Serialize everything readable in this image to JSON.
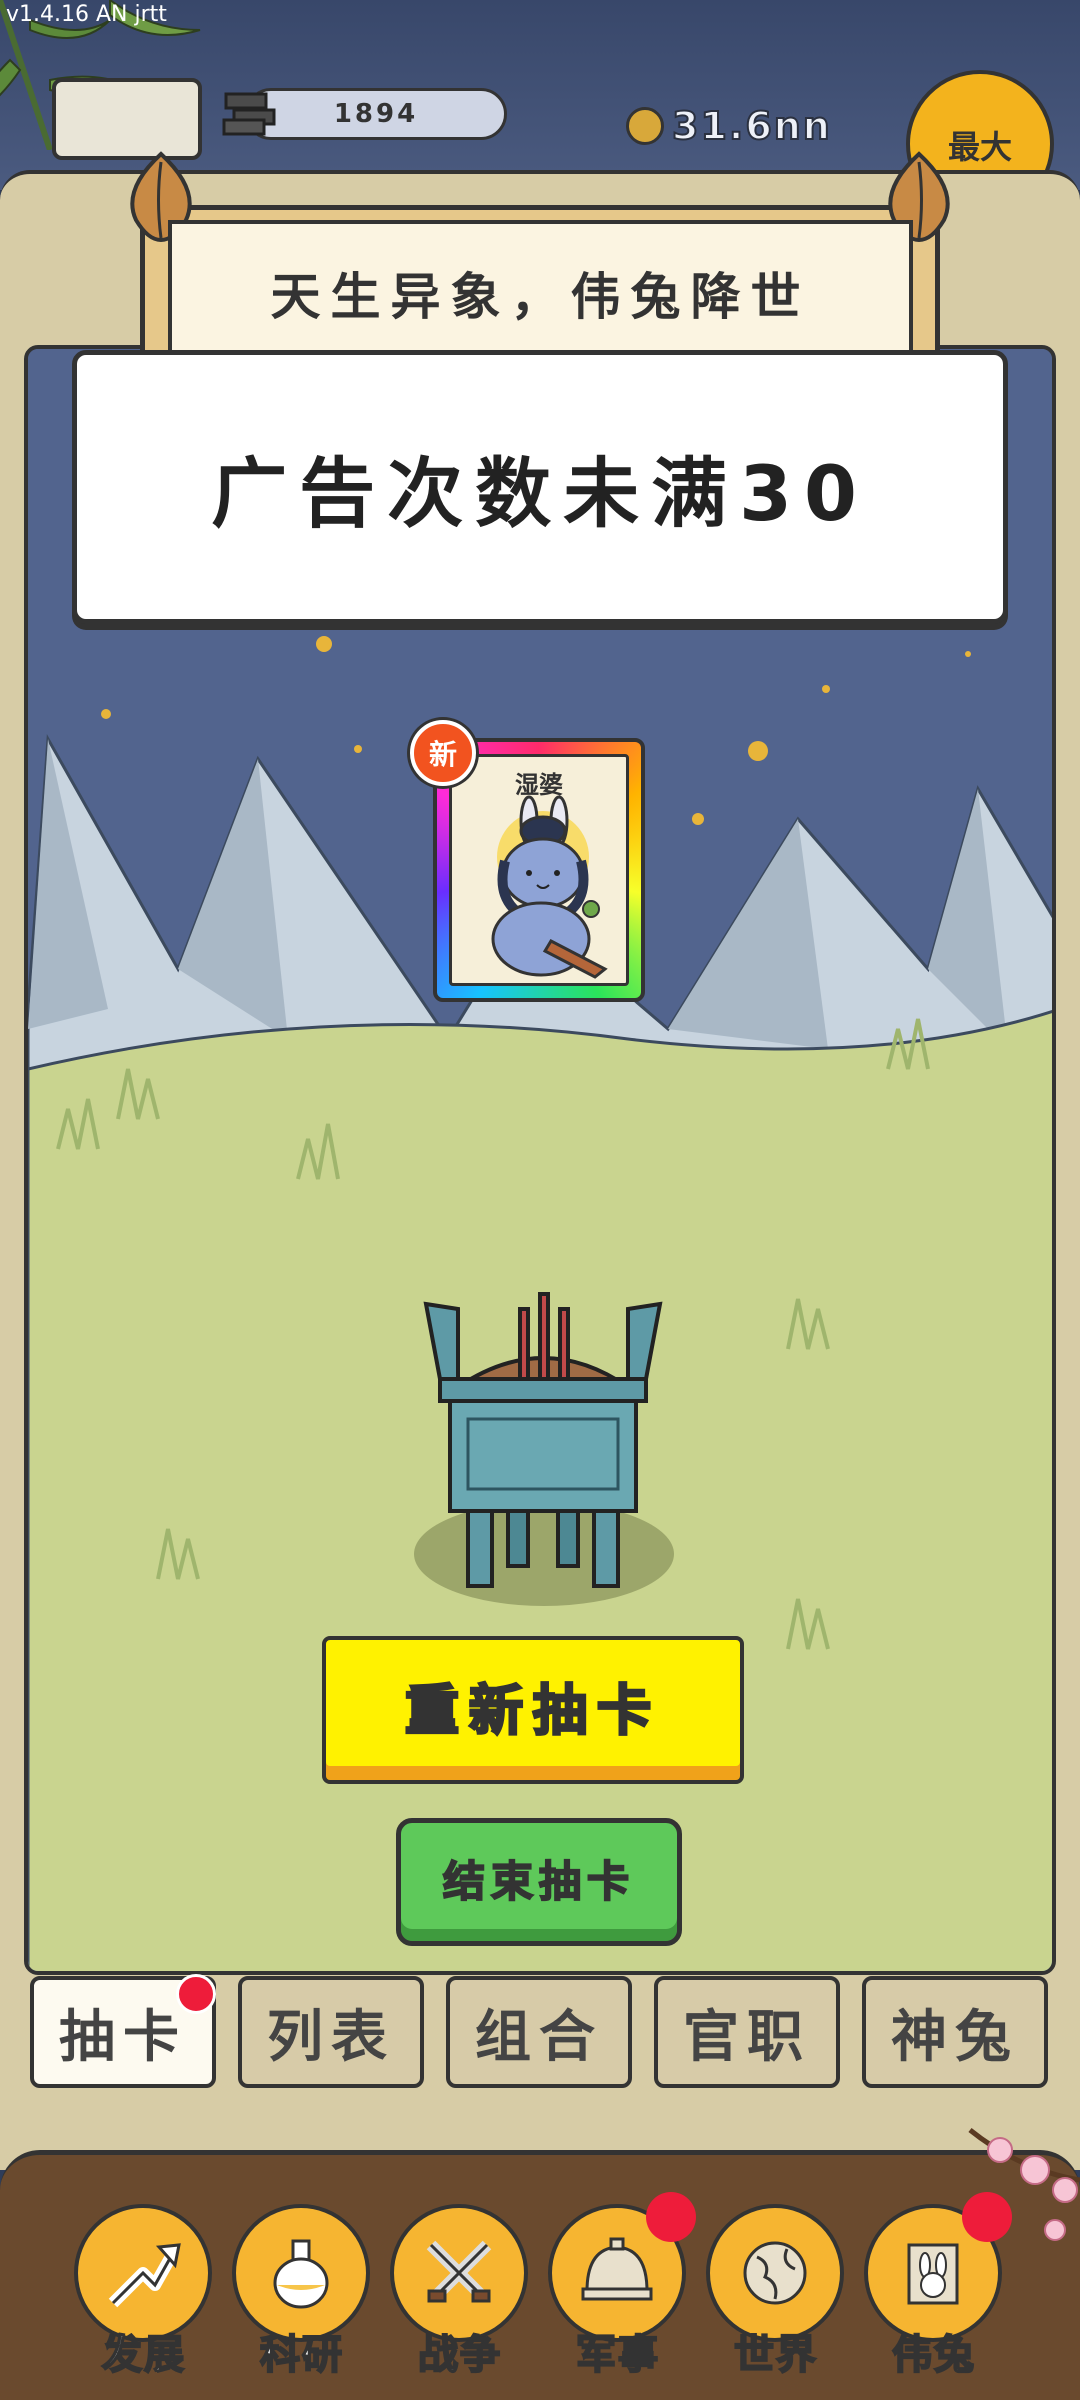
{
  "hud": {
    "version": "v1.4.16 AN jrtt",
    "stone_amount": "1894",
    "coins": "31.6nn",
    "max_button": "最大"
  },
  "header": {
    "title": "天生异象，伟兔降世"
  },
  "toast": {
    "message": "广告次数未满30"
  },
  "card": {
    "name": "湿婆",
    "badge": "新"
  },
  "actions": {
    "redraw": "重新抽卡",
    "end": "结束抽卡"
  },
  "tabs": [
    {
      "label": "抽卡",
      "active": true,
      "notify": true
    },
    {
      "label": "列表",
      "active": false,
      "notify": false
    },
    {
      "label": "组合",
      "active": false,
      "notify": false
    },
    {
      "label": "官职",
      "active": false,
      "notify": false
    },
    {
      "label": "神兔",
      "active": false,
      "notify": false
    }
  ],
  "nav": [
    {
      "label": "发展",
      "icon": "development-icon",
      "notify": false
    },
    {
      "label": "科研",
      "icon": "research-flask-icon",
      "notify": false
    },
    {
      "label": "战争",
      "icon": "crossed-swords-icon",
      "notify": false
    },
    {
      "label": "军事",
      "icon": "military-helmet-icon",
      "notify": true
    },
    {
      "label": "世界",
      "icon": "world-globe-icon",
      "notify": false
    },
    {
      "label": "伟兔",
      "icon": "rabbit-portrait-icon",
      "notify": true
    }
  ],
  "colors": {
    "redraw_button": "#fff200",
    "end_button": "#5ec95a",
    "badge": "#f2531f",
    "notify_dot": "#ee1c3a"
  }
}
